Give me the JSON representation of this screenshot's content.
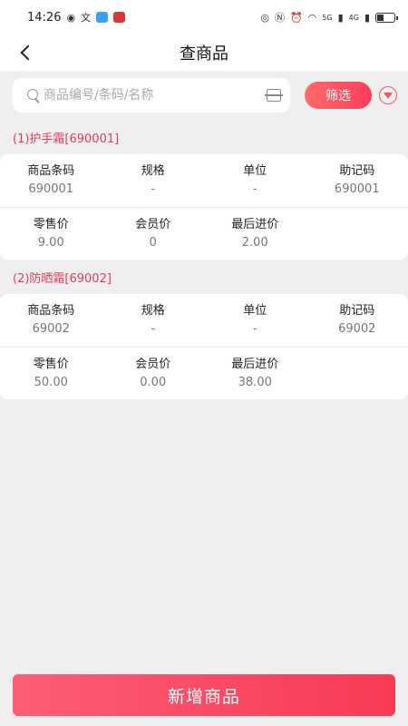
{
  "status_bar": {
    "time": "14:26",
    "network_5g": "5G",
    "network_4g": "4G"
  },
  "nav": {
    "title": "查商品"
  },
  "search": {
    "placeholder": "商品编号/条码/名称",
    "value": "",
    "filter_label": "筛选"
  },
  "products": [
    {
      "header": "(1)护手霜[690001]",
      "row1": [
        {
          "label": "商品条码",
          "value": "690001"
        },
        {
          "label": "规格",
          "value": "-"
        },
        {
          "label": "单位",
          "value": "-"
        },
        {
          "label": "助记码",
          "value": "690001"
        }
      ],
      "row2": [
        {
          "label": "零售价",
          "value": "9.00"
        },
        {
          "label": "会员价",
          "value": "0"
        },
        {
          "label": "最后进价",
          "value": "2.00"
        }
      ]
    },
    {
      "header": "(2)防晒霜[69002]",
      "row1": [
        {
          "label": "商品条码",
          "value": "69002"
        },
        {
          "label": "规格",
          "value": "-"
        },
        {
          "label": "单位",
          "value": "-"
        },
        {
          "label": "助记码",
          "value": "69002"
        }
      ],
      "row2": [
        {
          "label": "零售价",
          "value": "50.00"
        },
        {
          "label": "会员价",
          "value": "0.00"
        },
        {
          "label": "最后进价",
          "value": "38.00"
        }
      ]
    }
  ],
  "add_button_label": "新增商品",
  "colors": {
    "accent": "#f93a55",
    "accent_light": "#ff6b6b",
    "header_text": "#e63a5c",
    "background": "#efefef"
  }
}
